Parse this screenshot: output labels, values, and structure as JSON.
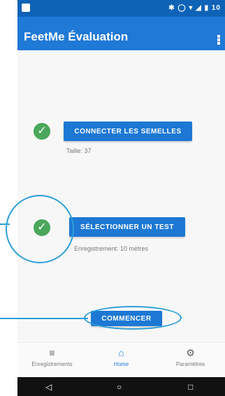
{
  "status": {
    "time": "10"
  },
  "appbar": {
    "title": "FeetMe Évaluation"
  },
  "rows": [
    {
      "button_label": "CONNECTER LES SEMELLES",
      "caption": "Taille: 37"
    },
    {
      "button_label": "SÉLECTIONNER UN TEST",
      "caption": "Enregistrement: 10 mètres"
    }
  ],
  "start_button": {
    "label": "COMMENCER"
  },
  "bottom_nav": [
    {
      "label": "Enregistrements",
      "icon": "list-icon"
    },
    {
      "label": "Home",
      "icon": "home-icon"
    },
    {
      "label": "Paramètres",
      "icon": "gear-icon"
    }
  ],
  "android_nav": {
    "back": "back-icon",
    "home": "circle-home-icon",
    "recent": "recent-apps-icon"
  },
  "colors": {
    "primary": "#1f79d7",
    "statusbar": "#0f63b7",
    "success": "#4aa75b",
    "highlight": "#2b9ed8"
  }
}
